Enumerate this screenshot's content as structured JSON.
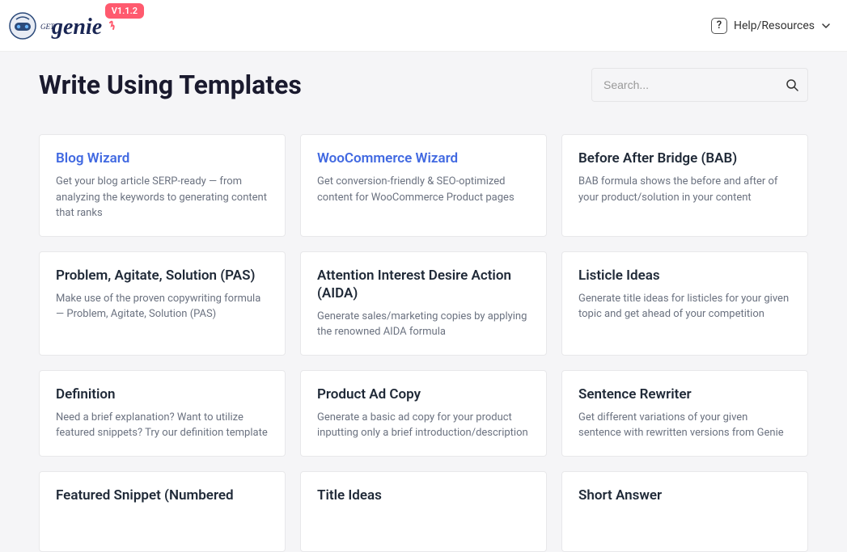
{
  "header": {
    "version": "V1.1.2",
    "help_label": "Help/Resources"
  },
  "page": {
    "title": "Write Using Templates",
    "search_placeholder": "Search..."
  },
  "templates": [
    {
      "title": "Blog Wizard",
      "desc": "Get your blog article SERP-ready — from analyzing the keywords to generating content that ranks",
      "accent": true
    },
    {
      "title": "WooCommerce Wizard",
      "desc": "Get conversion-friendly & SEO-optimized content for WooCommerce Product pages",
      "accent": true
    },
    {
      "title": "Before After Bridge (BAB)",
      "desc": "BAB formula shows the before and after of your product/solution in your content",
      "accent": false
    },
    {
      "title": "Problem, Agitate, Solution (PAS)",
      "desc": "Make use of the proven copywriting formula — Problem, Agitate, Solution (PAS)",
      "accent": false
    },
    {
      "title": "Attention Interest Desire Action (AIDA)",
      "desc": "Generate sales/marketing copies by applying the renowned AIDA formula",
      "accent": false
    },
    {
      "title": "Listicle Ideas",
      "desc": "Generate title ideas for listicles for your given topic and get ahead of your competition",
      "accent": false
    },
    {
      "title": "Definition",
      "desc": "Need a brief explanation? Want to utilize featured snippets? Try our definition template",
      "accent": false
    },
    {
      "title": "Product Ad Copy",
      "desc": "Generate a basic ad copy for your product inputting only a brief introduction/description",
      "accent": false
    },
    {
      "title": "Sentence Rewriter",
      "desc": "Get different variations of your given sentence with rewritten versions from Genie",
      "accent": false
    },
    {
      "title": "Featured Snippet (Numbered",
      "desc": "",
      "accent": false
    },
    {
      "title": "Title Ideas",
      "desc": "",
      "accent": false
    },
    {
      "title": "Short Answer",
      "desc": "",
      "accent": false
    }
  ]
}
